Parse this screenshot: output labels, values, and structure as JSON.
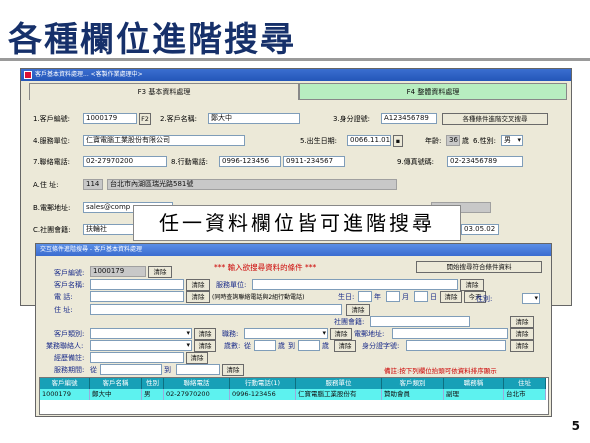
{
  "slide": {
    "title": "各種欄位進階搜尋",
    "page_number": "5"
  },
  "main_window": {
    "title": "客戶基本資料處理... <客製作業處理中>",
    "tabs": [
      {
        "label": "F3 基本資料處理"
      },
      {
        "label": "F4 整體資料處理"
      }
    ],
    "fields": {
      "customer_id_label": "1.客戶編號:",
      "customer_id": "1000179",
      "customer_id_btn": "F2",
      "customer_name_label": "2.客戶名稱:",
      "customer_name": "鄭大中",
      "id_number_label": "3.身分證號:",
      "id_number": "A123456789",
      "adv_search_btn": "各種條件進階交叉搜尋",
      "company_label": "4.服務單位:",
      "company": "仁寶電腦工業股份有限公司",
      "birthday_label": "5.出生日期:",
      "birthday": "0066.11.01",
      "age_label": "年齡:",
      "age": "36",
      "age_unit": "歲",
      "gender_label": "6.性別:",
      "gender": "男",
      "phone_label": "7.聯絡電話:",
      "phone": "02-27970200",
      "mobile_label": "8.行動電話:",
      "mobile": "0996-123456",
      "mobile2": "0911-234567",
      "fax_label": "9.傳真號碼:",
      "fax": "02-23456789",
      "address_label": "A.住  址:",
      "zip": "114",
      "address": "台北市內湖區瑞光路581號",
      "email_label": "B.電郵地址:",
      "email": "sales@comp",
      "community_label": "C.社團會籍:",
      "community": "扶輪社",
      "right_date": "03.05.02"
    }
  },
  "callout": {
    "text": "任一資料欄位皆可進階搜尋"
  },
  "search_window": {
    "title": "交互條件進階搜尋 - 客戶基本資料處理",
    "header_text": "*** 輸入欲搜尋資料的條件 ***",
    "start_search_btn": "開始搜尋符合條件資料",
    "clear": "清除",
    "today": "今天",
    "row1": {
      "id_label": "客戶編號:",
      "id_value": "1000179"
    },
    "row2": {
      "name_label": "客戶名稱:",
      "company_label": "服務單位:"
    },
    "row3": {
      "phone_label": "電  話:",
      "phone_note": "(同時查詢聯絡電話與2組行動電話)",
      "birthday_label": "生日:",
      "year": "年",
      "month": "月",
      "day": "日"
    },
    "row4": {
      "address_label": "住  址:",
      "gender_label": "性別:"
    },
    "row5": {
      "community_label": "社團會籍:"
    },
    "row6": {
      "category_label": "客戶類別:",
      "title_label": "職務:",
      "email_label": "電郵地址:"
    },
    "row7": {
      "sales_label": "業務聯絡人:",
      "age_label": "歲數:",
      "from": "從",
      "to": "到",
      "age_unit": "歲",
      "id_label": "身分證字號:"
    },
    "row8": {
      "remark_label": "經歷備註:"
    },
    "row9": {
      "period_label": "服務期間:",
      "from": "從",
      "to": "到",
      "hint": "備註:按下列欄位抬頭可依資料排序顯示"
    },
    "grid": {
      "columns": [
        "客戶編號",
        "客戶名稱",
        "性別",
        "聯絡電話",
        "行動電話(1)",
        "服務單位",
        "客戶類別",
        "職務稱",
        "住址"
      ],
      "rows": [
        [
          "1000179",
          "鄭大中",
          "男",
          "02-27970200",
          "0996-123456",
          "仁寶電腦工業股份有",
          "贊助會員",
          "副理",
          "台北市"
        ]
      ]
    }
  }
}
